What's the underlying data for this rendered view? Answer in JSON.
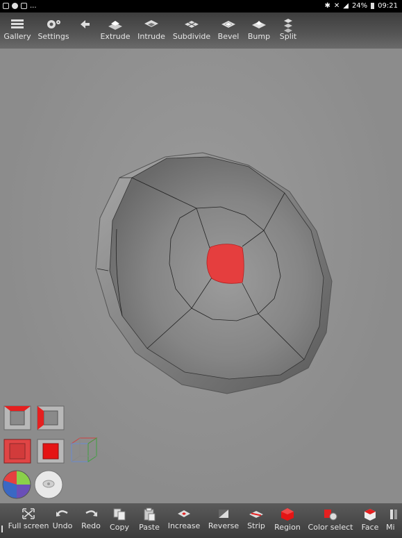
{
  "status_bar": {
    "battery": "24%",
    "time": "09:21",
    "left_extra": "..."
  },
  "top_toolbar": [
    {
      "label": "Gallery",
      "icon": "gallery-icon"
    },
    {
      "label": "Settings",
      "icon": "gear-icon"
    },
    {
      "label": "",
      "icon": "back-arrow-icon"
    },
    {
      "label": "Extrude",
      "icon": "extrude-icon"
    },
    {
      "label": "Intrude",
      "icon": "intrude-icon"
    },
    {
      "label": "Subdivide",
      "icon": "subdivide-icon"
    },
    {
      "label": "Bevel",
      "icon": "bevel-icon"
    },
    {
      "label": "Bump",
      "icon": "bump-icon"
    },
    {
      "label": "Split",
      "icon": "split-icon"
    }
  ],
  "bottom_toolbar": [
    {
      "label": "Full screen",
      "icon": "fullscreen-icon"
    },
    {
      "label": "Undo",
      "icon": "undo-icon"
    },
    {
      "label": "Redo",
      "icon": "redo-icon"
    },
    {
      "label": "Copy",
      "icon": "copy-icon"
    },
    {
      "label": "Paste",
      "icon": "paste-icon"
    },
    {
      "label": "Increase",
      "icon": "increase-icon"
    },
    {
      "label": "Reverse",
      "icon": "reverse-icon"
    },
    {
      "label": "Strip",
      "icon": "strip-icon"
    },
    {
      "label": "Region",
      "icon": "region-icon"
    },
    {
      "label": "Color select",
      "icon": "color-select-icon"
    },
    {
      "label": "Face",
      "icon": "face-icon"
    },
    {
      "label": "Mi",
      "icon": "mirror-icon"
    }
  ],
  "colors": {
    "selection": "#e53e3e",
    "viewport": "#8f8f8f",
    "toolbar": "#4a4a4a"
  }
}
